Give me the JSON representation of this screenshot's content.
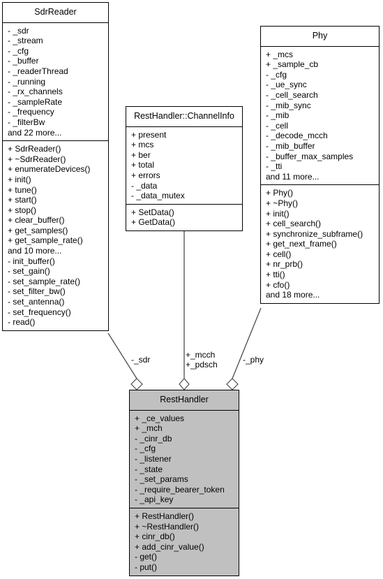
{
  "diagram": {
    "type": "uml-class-diagram",
    "background": "#ffffff",
    "line_color": "#000000",
    "highlight_fill": "#c0c0c0"
  },
  "classes": {
    "sdr_reader": {
      "name": "SdrReader",
      "attributes": [
        "- _sdr",
        "- _stream",
        "- _cfg",
        "- _buffer",
        "- _readerThread",
        "- _running",
        "- _rx_channels",
        "- _sampleRate",
        "- _frequency",
        "- _filterBw",
        "and 22 more..."
      ],
      "methods": [
        "+ SdrReader()",
        "+ ~SdrReader()",
        "+ enumerateDevices()",
        "+ init()",
        "+ tune()",
        "+ start()",
        "+ stop()",
        "+ clear_buffer()",
        "+ get_samples()",
        "+ get_sample_rate()",
        "and 10 more...",
        "- init_buffer()",
        "- set_gain()",
        "- set_sample_rate()",
        "- set_filter_bw()",
        "- set_antenna()",
        "- set_frequency()",
        "- read()"
      ]
    },
    "channel_info": {
      "name": "RestHandler::ChannelInfo",
      "attributes": [
        "+ present",
        "+ mcs",
        "+ ber",
        "+ total",
        "+ errors",
        "- _data",
        "- _data_mutex"
      ],
      "methods": [
        "+ SetData()",
        "+ GetData()"
      ]
    },
    "phy": {
      "name": "Phy",
      "attributes": [
        "+ _mcs",
        "+ _sample_cb",
        "- _cfg",
        "- _ue_sync",
        "- _cell_search",
        "- _mib_sync",
        "- _mib",
        "- _cell",
        "- _decode_mcch",
        "- _mib_buffer",
        "- _buffer_max_samples",
        "- _tti",
        "and 11 more..."
      ],
      "methods": [
        "+ Phy()",
        "+ ~Phy()",
        "+ init()",
        "+ cell_search()",
        "+ synchronize_subframe()",
        "+ get_next_frame()",
        "+ cell()",
        "+ nr_prb()",
        "+ tti()",
        "+ cfo()",
        "and 18 more..."
      ]
    },
    "rest_handler": {
      "name": "RestHandler",
      "attributes": [
        "+ _ce_values",
        "+ _mch",
        "- _cinr_db",
        "- _cfg",
        "- _listener",
        "- _state",
        "- _set_params",
        "- _require_bearer_token",
        "- _api_key"
      ],
      "methods": [
        "+ RestHandler()",
        "+ ~RestHandler()",
        "+ cinr_db()",
        "+ add_cinr_value()",
        "- get()",
        "- put()"
      ]
    }
  },
  "relations": [
    {
      "id": "sdr",
      "label": "-_sdr",
      "from": "sdr_reader",
      "to": "rest_handler",
      "kind": "aggregation"
    },
    {
      "id": "mcch_pdsch",
      "label_line1": "+_mcch",
      "label_line2": "+_pdsch",
      "from": "channel_info",
      "to": "rest_handler",
      "kind": "aggregation"
    },
    {
      "id": "phy",
      "label": "-_phy",
      "from": "phy",
      "to": "rest_handler",
      "kind": "aggregation"
    }
  ]
}
